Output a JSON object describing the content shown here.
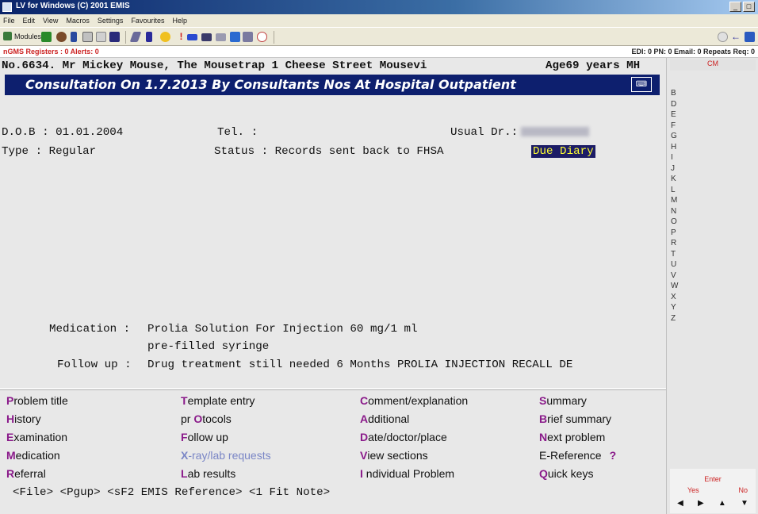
{
  "window": {
    "title": "LV for Windows (C) 2001 EMIS"
  },
  "menu": [
    "File",
    "Edit",
    "View",
    "Macros",
    "Settings",
    "Favourites",
    "Help"
  ],
  "toolbar": {
    "modules_label": "Modules",
    "icons": [
      "people-icon",
      "drug-icon",
      "book-icon",
      "copy-icon",
      "print-icon",
      "user-icon",
      "letter-icon",
      "star-icon",
      "alert-icon",
      "message-icon",
      "email-icon",
      "screen-icon",
      "calendar-icon",
      "arrow-icon"
    ],
    "right_icons": [
      "stop-icon",
      "back-icon",
      "save-icon"
    ]
  },
  "status": {
    "left": "nGMS Registers : 0  Alerts: 0",
    "right": "EDI: 0  PN: 0  Email: 0  Repeats Req: 0"
  },
  "patient": {
    "line": "No.6634. Mr Mickey Mouse, The Mousetrap 1 Cheese Street Mousevi",
    "age": "Age69 years MH"
  },
  "consultation": {
    "banner": "Consultation On 1.7.2013 By Consultants Nos At Hospital Outpatient",
    "dob": "D.O.B : 01.01.2004",
    "tel": "Tel.  :",
    "usual_dr": "Usual Dr.:",
    "type": "Type  : Regular",
    "status": "Status : Records sent back to FHSA",
    "due_diary": "Due Diary"
  },
  "entries": {
    "medication_label": "Medication :",
    "medication_line1": "Prolia Solution For Injection 60 mg/1 ml",
    "medication_line2": "pre-filled syringe",
    "followup_label": "Follow up :",
    "followup_text": "Drug treatment still needed 6 Months PROLIA INJECTION RECALL DE"
  },
  "commands": [
    {
      "hot": "P",
      "rest": "roblem title",
      "disabled": false
    },
    {
      "hot": "H",
      "rest": "istory",
      "disabled": false
    },
    {
      "hot": "E",
      "rest": "xamination",
      "disabled": false
    },
    {
      "hot": "M",
      "rest": "edication",
      "disabled": false
    },
    {
      "hot": "R",
      "rest": "eferral",
      "disabled": false
    },
    {
      "hot": "T",
      "rest": "emplate entry",
      "disabled": false
    },
    {
      "pre": "pr ",
      "hot": "O",
      "rest": "tocols",
      "disabled": false
    },
    {
      "hot": "F",
      "rest": "ollow up",
      "disabled": false
    },
    {
      "hot": "X",
      "rest": "-ray/lab requests",
      "disabled": true
    },
    {
      "hot": "L",
      "rest": "ab results",
      "disabled": false
    },
    {
      "hot": "C",
      "rest": "omment/explanation",
      "disabled": false
    },
    {
      "hot": "A",
      "rest": "dditional",
      "disabled": false
    },
    {
      "hot": "D",
      "rest": "ate/doctor/place",
      "disabled": false
    },
    {
      "hot": "V",
      "rest": "iew sections",
      "disabled": false
    },
    {
      "hot": "I",
      "rest": " ndividual Problem",
      "disabled": false
    },
    {
      "hot": "S",
      "rest": "ummary",
      "disabled": false
    },
    {
      "hot": "B",
      "rest": "rief summary",
      "disabled": false
    },
    {
      "hot": "N",
      "rest": "ext problem",
      "disabled": false
    },
    {
      "hot": "",
      "rest": "E-Reference",
      "disabled": false,
      "suffix": "?"
    },
    {
      "hot": "Q",
      "rest": "uick keys",
      "disabled": false
    }
  ],
  "keyline": "<File> <Pgup> <sF2 EMIS Reference> <1 Fit Note>",
  "sidebar": {
    "header": "CM",
    "letters": [
      "B",
      "D",
      "E",
      "F",
      "G",
      "H",
      "I",
      "J",
      "K",
      "L",
      "M",
      "N",
      "O",
      "P",
      "R",
      "T",
      "U",
      "V",
      "W",
      "X",
      "Y",
      "Z"
    ],
    "enter": "Enter",
    "yes": "Yes",
    "no": "No"
  }
}
